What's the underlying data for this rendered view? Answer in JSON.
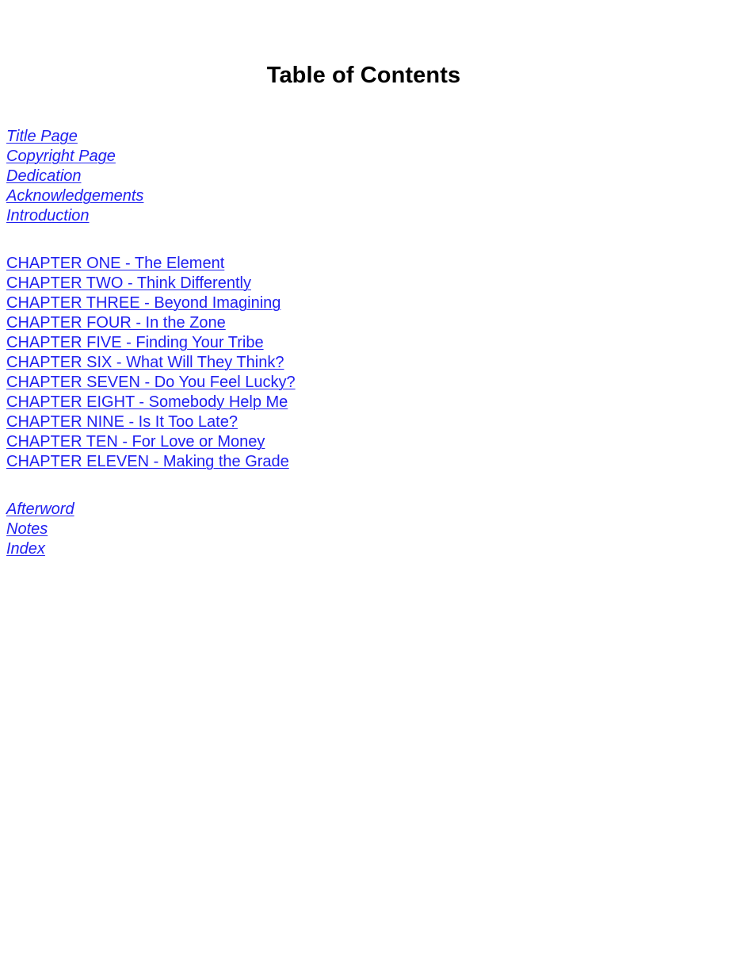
{
  "page": {
    "title": "Table of Contents",
    "background_color": "#ffffff",
    "link_color": "#2020f0",
    "title_color": "#000000"
  },
  "sections": [
    {
      "name": "front-matter",
      "style": "italic",
      "items": [
        {
          "label": "Title Page"
        },
        {
          "label": "Copyright Page"
        },
        {
          "label": "Dedication"
        },
        {
          "label": "Acknowledgements"
        },
        {
          "label": "Introduction"
        }
      ]
    },
    {
      "name": "chapters",
      "style": "upright",
      "items": [
        {
          "label": "CHAPTER ONE - The Element"
        },
        {
          "label": "CHAPTER TWO - Think Differently"
        },
        {
          "label": "CHAPTER THREE - Beyond Imagining"
        },
        {
          "label": "CHAPTER FOUR - In the Zone"
        },
        {
          "label": "CHAPTER FIVE - Finding Your Tribe"
        },
        {
          "label": "CHAPTER SIX - What Will They Think?"
        },
        {
          "label": "CHAPTER SEVEN - Do You Feel Lucky?"
        },
        {
          "label": "CHAPTER EIGHT - Somebody Help Me"
        },
        {
          "label": "CHAPTER NINE - Is It Too Late?"
        },
        {
          "label": "CHAPTER TEN - For Love or Money"
        },
        {
          "label": "CHAPTER ELEVEN - Making the Grade"
        }
      ]
    },
    {
      "name": "back-matter",
      "style": "italic",
      "items": [
        {
          "label": "Afterword"
        },
        {
          "label": "Notes"
        },
        {
          "label": "Index"
        }
      ]
    }
  ]
}
